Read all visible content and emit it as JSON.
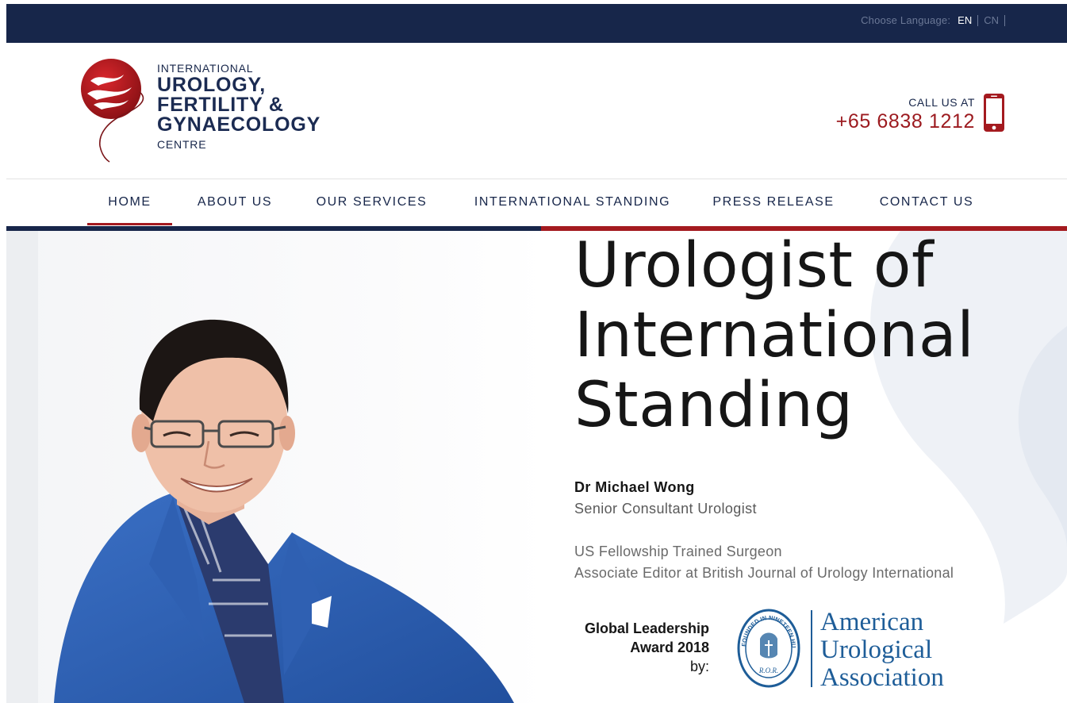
{
  "topbar": {
    "language_label": "Choose Language:",
    "languages": [
      {
        "code": "EN",
        "active": true
      },
      {
        "code": "CN",
        "active": false
      }
    ]
  },
  "brand": {
    "line1": "INTERNATIONAL",
    "line2": "UROLOGY,",
    "line3": "FERTILITY &",
    "line4": "GYNAECOLOGY",
    "line5": "CENTRE",
    "logo_icon": "red-circle-swirl-logo"
  },
  "call": {
    "label": "CALL US AT",
    "number": "+65 6838 1212",
    "icon": "mobile-phone-icon"
  },
  "nav": {
    "items": [
      {
        "label": "HOME",
        "active": true
      },
      {
        "label": "ABOUT US",
        "active": false
      },
      {
        "label": "OUR SERVICES",
        "active": false
      },
      {
        "label": "INTERNATIONAL STANDING",
        "active": false
      },
      {
        "label": "PRESS RELEASE",
        "active": false
      },
      {
        "label": "CONTACT US",
        "active": false
      }
    ]
  },
  "hero": {
    "headline": [
      "Urologist of",
      "International",
      "Standing"
    ],
    "doctor_name": "Dr Michael Wong",
    "doctor_title": "Senior Consultant Urologist",
    "credentials": [
      "US Fellowship Trained Surgeon",
      "Associate Editor at British Journal of Urology International"
    ],
    "award": {
      "line1": "Global Leadership",
      "line2": "Award 2018",
      "line3": "by:"
    },
    "association": {
      "name_lines": [
        "American",
        "Urological",
        "Association"
      ],
      "seal_text": "FOUNDED IN NINETEEN HUNDRED TWO",
      "seal_initials": "R.O.R."
    }
  },
  "colors": {
    "navy": "#17264a",
    "brand_red": "#a41a1f",
    "aua_blue": "#1e5d98"
  }
}
